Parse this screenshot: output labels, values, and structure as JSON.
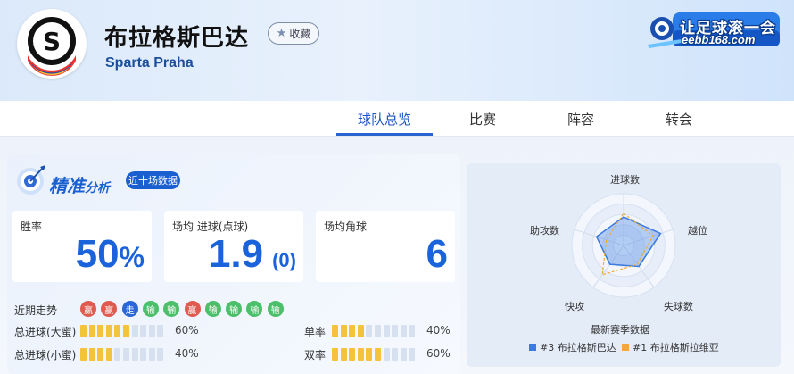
{
  "header": {
    "team_name_cn": "布拉格斯巴达",
    "team_name_en": "Sparta Praha",
    "favorite_label": "收藏",
    "brand_line1": "让足球滚一会",
    "brand_line2": "eebb168.com",
    "logo_letter": "S"
  },
  "nav": {
    "tabs": [
      {
        "label": "球队总览",
        "active": true
      },
      {
        "label": "比赛",
        "active": false
      },
      {
        "label": "阵容",
        "active": false
      },
      {
        "label": "转会",
        "active": false
      }
    ]
  },
  "analysis": {
    "title_main": "精准",
    "title_sub": "分析",
    "badge": "近十场数据",
    "cards": [
      {
        "label": "胜率",
        "value": "50",
        "unit": "%"
      },
      {
        "label": "场均 进球(点球)",
        "value": "1.9",
        "sub": "(0)"
      },
      {
        "label": "场均角球",
        "value": "6"
      }
    ],
    "recent_form_label": "近期走势",
    "recent_form": [
      {
        "text": "赢",
        "color": "#e05a4f"
      },
      {
        "text": "赢",
        "color": "#e05a4f"
      },
      {
        "text": "走",
        "color": "#2c67d6"
      },
      {
        "text": "输",
        "color": "#4cbf6b"
      },
      {
        "text": "输",
        "color": "#4cbf6b"
      },
      {
        "text": "赢",
        "color": "#e05a4f"
      },
      {
        "text": "输",
        "color": "#4cbf6b"
      },
      {
        "text": "输",
        "color": "#4cbf6b"
      },
      {
        "text": "输",
        "color": "#4cbf6b"
      },
      {
        "text": "输",
        "color": "#4cbf6b"
      }
    ],
    "metrics": [
      {
        "label": "总进球(大蜜)",
        "pct_label": "60%",
        "fraction": 0.6
      },
      {
        "label": "总进球(小蜜)",
        "pct_label": "40%",
        "fraction": 0.4
      },
      {
        "label": "单率",
        "pct_label": "40%",
        "fraction": 0.4
      },
      {
        "label": "双率",
        "pct_label": "60%",
        "fraction": 0.6
      }
    ],
    "bar_colors": {
      "filled": "#f5c33b",
      "empty": "#d6e0ee"
    }
  },
  "radar": {
    "axes": [
      "进球数",
      "越位",
      "失球数",
      "快攻",
      "助攻数"
    ],
    "legend_title": "最新赛季数据",
    "series": [
      {
        "name": "#3 布拉格斯巴达",
        "color": "#3b7be0",
        "values": [
          0.55,
          0.75,
          0.5,
          0.45,
          0.55
        ]
      },
      {
        "name": "#1 布拉格斯拉维亚",
        "color": "#f0a93a",
        "values": [
          0.62,
          0.6,
          0.45,
          0.7,
          0.35
        ]
      }
    ]
  }
}
